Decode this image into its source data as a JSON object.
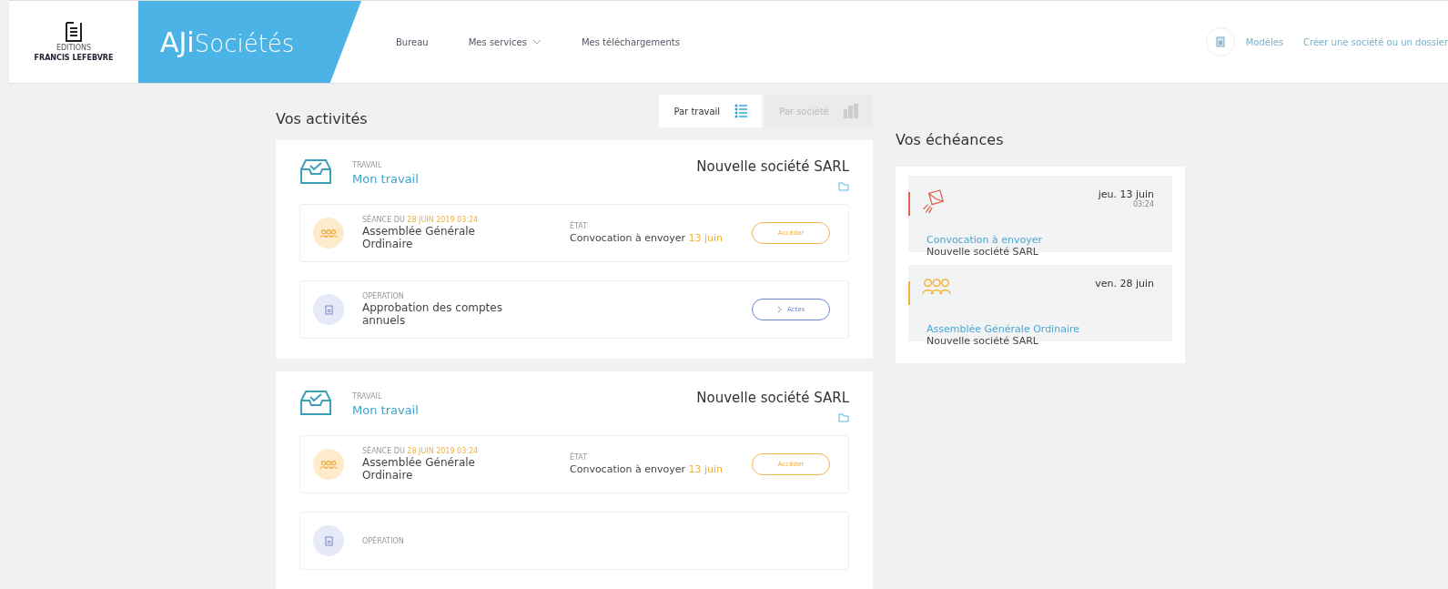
{
  "brand": {
    "publisher_small": "EDITIONS",
    "publisher": "FRANCIS LEFEBVRE",
    "app_bold": "AJi",
    "app": "Sociétés"
  },
  "nav": [
    {
      "label": "Bureau",
      "dropdown": false
    },
    {
      "label": "Mes services",
      "dropdown": true
    },
    {
      "label": "Mes téléchargements",
      "dropdown": false
    }
  ],
  "header_actions": {
    "models": "Modèles",
    "create": "Créer une société ou un dossier"
  },
  "activities": {
    "title": "Vos activités",
    "views": [
      {
        "label": "Par travail",
        "kind": "list",
        "selected": true
      },
      {
        "label": "Par société",
        "kind": "chart",
        "selected": false
      }
    ],
    "cards": [
      {
        "label": "TRAVAIL",
        "work": "Mon travail",
        "company": "Nouvelle société SARL",
        "items": [
          {
            "kind": "seance",
            "label": "SÉANCE DU",
            "date": "28 JUIN 2019 03:24",
            "title": "Assemblée Générale Ordinaire",
            "state_label": "ÉTAT",
            "state": "Convocation à envoyer",
            "state_date": "13 juin",
            "button": "Accéder"
          },
          {
            "kind": "operation",
            "label": "OPÉRATION",
            "title": "Approbation des comptes annuels",
            "button": "Actes"
          }
        ]
      },
      {
        "label": "TRAVAIL",
        "work": "Mon travail",
        "company": "Nouvelle société SARL",
        "items": [
          {
            "kind": "seance",
            "label": "SÉANCE DU",
            "date": "28 JUIN 2019 03:24",
            "title": "Assemblée Générale Ordinaire",
            "state_label": "ÉTAT",
            "state": "Convocation à envoyer",
            "state_date": "13 juin",
            "button": "Accéder"
          },
          {
            "kind": "operation",
            "label": "OPÉRATION"
          }
        ]
      }
    ]
  },
  "deadlines": {
    "title": "Vos échéances",
    "items": [
      {
        "kind": "mail",
        "color": "#e0644f",
        "date": "jeu. 13 juin",
        "time": "03:24",
        "title": "Convocation à envoyer",
        "company": "Nouvelle société SARL"
      },
      {
        "kind": "people",
        "color": "#f0b43c",
        "date": "ven. 28 juin",
        "title": "Assemblée Générale Ordinaire",
        "company": "Nouvelle société SARL"
      }
    ]
  }
}
